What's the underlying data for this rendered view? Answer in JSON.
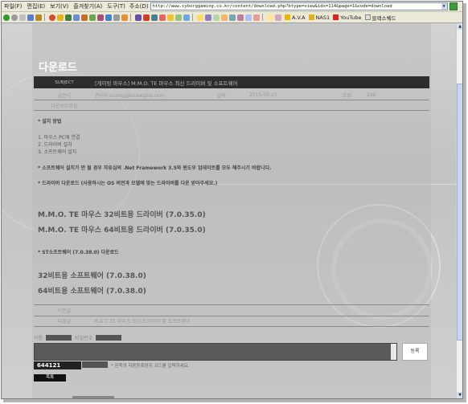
{
  "menubar": {
    "items": [
      "파일(F)",
      "편집(E)",
      "보기(V)",
      "즐겨찾기(A)",
      "도구(T)"
    ],
    "address_label": "주소(D)",
    "address_url": "http://www.cyborggaming.co.kr/content/download.php?btype=view&idx=114&page=1&code=download"
  },
  "bookmarks": [
    {
      "label": "A.V.A",
      "icon": "star-icon"
    },
    {
      "label": "NAS1",
      "icon": "folder-icon"
    },
    {
      "label": "YouTube",
      "icon": "youtube-icon"
    },
    {
      "label": "블랙스퀘드",
      "icon": "page-icon"
    }
  ],
  "page": {
    "title": "다운로드",
    "subject_label": "SUBJECT",
    "subject_text": "[게이밍 마우스] M.M.O. TE 마우스 최신 드라이버 및 소프트웨어",
    "meta": {
      "writer_label": "글쓴이",
      "writer_value": "관리자  cusmp@ocealpha.com",
      "date_label": "날짜",
      "date_value": "2015-05-27",
      "views_label": "조회",
      "views_value": "288"
    },
    "attach_label": "다운로드파일",
    "install_heading": "* 설치 방법",
    "install_steps": [
      "1. 마우스 PC에 연결",
      "2. 드라이버 설치",
      "3. 소프트웨어 설치"
    ],
    "note1": "* 소프트웨어 설치가 안 될 경우 자유심의 .Net Framework 3.5와 윈도우 업데이트를 모두 해주시기 바랍니다.",
    "note2": "* 드라이버 다운로드 (사용하시는 OS 버전과 모델에 맞는 드라이버를 다운 받아주세요.)",
    "driver_32": "M.M.O. TE 마우스 32비트용 드라이버 (7.0.35.0)",
    "driver_64": "M.M.O. TE 마우스 64비트용 드라이버 (7.0.35.0)",
    "st_note": "* ST소프트웨어 (7.0.38.0) 다운로드",
    "sw_32": "32비트용 소프트웨어 (7.0.38.0)",
    "sw_64": "64비트용 소프트웨어 (7.0.38.0)",
    "prev_label": "이전글",
    "prev_value": "",
    "next_label": "다음글",
    "next_value": "R.A.T. TE 마우스 최신 드라이버 및 소프트웨어",
    "comment_name_label": "이름",
    "comment_pw_label": "비밀번호",
    "comment_submit": "등록",
    "captcha_code": "644121",
    "captcha_hint": "* 왼쪽의 자동등록방지 코드를 입력하세요.",
    "list_button": "목록"
  }
}
